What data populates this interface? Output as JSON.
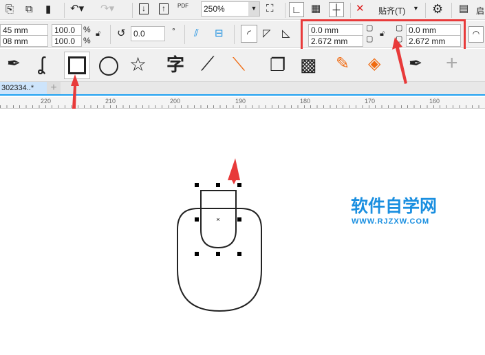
{
  "toolbar": {
    "zoom": "250%",
    "snap_label": "贴齐(T)",
    "launch_label": "启"
  },
  "property_bar": {
    "size_w": "45 mm",
    "size_h": "08 mm",
    "scale_x": "100.0",
    "scale_y": "100.0",
    "percent": "%",
    "rotation": "0.0",
    "degree": "°",
    "corner_tl": "0.0 mm",
    "corner_bl": "2.672 mm",
    "corner_tr": "0.0 mm",
    "corner_br": "2.672 mm"
  },
  "tabs": [
    {
      "label": "302334..*"
    }
  ],
  "ruler": {
    "ticks": [
      "220",
      "210",
      "200",
      "190",
      "180",
      "170",
      "160"
    ]
  },
  "watermark": {
    "title": "软件自学网",
    "url": "WWW.RJZXW.COM"
  },
  "colors": {
    "accent": "#1ea1f2",
    "highlight": "#e83a3a",
    "watermark": "#1a8fe0",
    "orange": "#f06a10"
  }
}
